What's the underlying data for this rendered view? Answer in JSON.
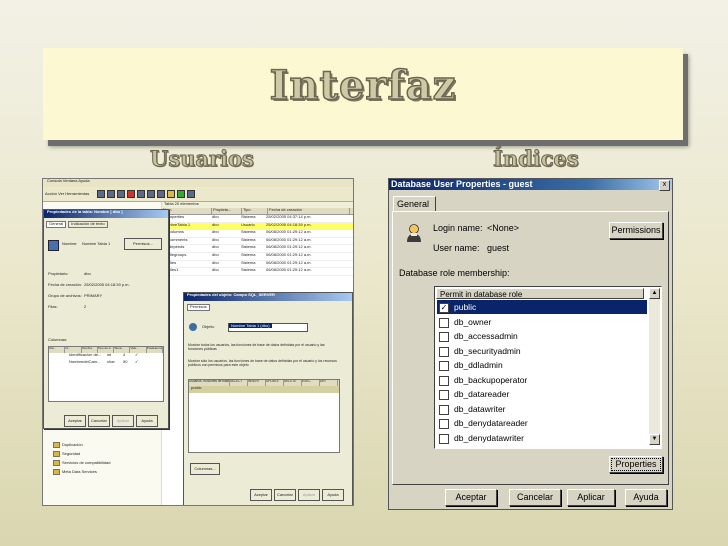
{
  "slide": {
    "title": "Interfaz",
    "left_label": "Usuarios",
    "right_label": "Índices"
  },
  "left_shot": {
    "menu": "Consola  Ventana  Ayuda",
    "toolbar_text": "Acción  Ver  Herramientas",
    "table_header": "Tabla   20 elementos",
    "columns": [
      "Nom",
      "Propieta...",
      "Tipo",
      "Fecha de creación"
    ],
    "rows": [
      [
        "dtproperties",
        "dbo",
        "Sistema",
        "25/02/2005 04:37:14 p.m."
      ],
      [
        "NombreTabla 1",
        "dbo",
        "Usuario",
        "25/02/2005 04:18:39 p.m."
      ],
      [
        "syscolumns",
        "dbo",
        "Sistema",
        "06/08/2000 01:29:12 a.m."
      ],
      [
        "syscomments",
        "dbo",
        "Sistema",
        "06/08/2000 01:29:12 a.m."
      ],
      [
        "sysdepends",
        "dbo",
        "Sistema",
        "06/08/2000 01:29:12 a.m."
      ],
      [
        "sysfilegroups",
        "dbo",
        "Sistema",
        "06/08/2000 01:29:12 a.m."
      ],
      [
        "sysfiles",
        "dbo",
        "Sistema",
        "06/08/2000 01:29:12 a.m."
      ],
      [
        "sysfiles1",
        "dbo",
        "Sistema",
        "06/08/2000 01:29:12 a.m."
      ]
    ],
    "props_dialog": {
      "title": "Propiedades de la tabla: Nombre [ dbo ]",
      "tabs": [
        "General",
        "Indicación de texto"
      ],
      "name_label": "Nombre:",
      "name_value": "Nombre Tabla 1",
      "perms_button": "Permisos...",
      "fields": [
        [
          "Propietario:",
          "dbo"
        ],
        [
          "Fecha de creación:",
          "25/02/2005 04:18:39 p.m."
        ],
        [
          "Grupo de archivos:",
          "PRIMARY"
        ],
        [
          "Filas:",
          "2"
        ]
      ],
      "columns_label": "Columnas:",
      "col_headers": [
        "Cla...",
        "Id...",
        "Nombre",
        "Tipo de d...",
        "Tama...",
        "Valo...",
        "Predetermin..."
      ],
      "col_rows": [
        [
          "",
          "",
          "Identificación de...",
          "int",
          "4",
          "✓"
        ],
        [
          "",
          "",
          "NombredelCam...",
          "char",
          "50",
          "✓"
        ]
      ],
      "buttons": [
        "Aceptar",
        "Cancelar",
        "Aplicar",
        "Ayuda"
      ]
    },
    "perm_dialog": {
      "title": "Propiedades del objeto: Campo SQL_SERVER",
      "tab": "Permisos",
      "object_label": "Objeto:",
      "object_value": "Nombre Tabla 1 (dbo)",
      "option1": "Mostrar todos los usuarios, las funciones de base de datos definidas por el usuario y las funciones públicas",
      "option2": "Mostrar sólo los usuarios, las funciones de base de datos definidas por el usuario y los recursos públicos con permisos para este objeto",
      "grid_headers": [
        "Usuarios, funciones de base",
        "SELECT",
        "INSERT",
        "UPDATE",
        "DELETE",
        "EXEC",
        "DRI"
      ],
      "grid_row": "public",
      "users_button": "Columnas...",
      "buttons": [
        "Aceptar",
        "Cancelar",
        "Aplicar",
        "Ayuda"
      ]
    },
    "tree_items": [
      "Duplicación",
      "Seguridad",
      "Servicios de compatibilidad",
      "Meta Data Services"
    ]
  },
  "right_shot": {
    "window_title": "Database User Properties - guest",
    "close_glyph": "x",
    "tab": "General",
    "login_label": "Login name:",
    "login_value": "<None>",
    "user_label": "User name:",
    "user_value": "guest",
    "permissions_button": "Permissions",
    "role_label": "Database role membership:",
    "list_header": "Permit in database role",
    "roles": [
      {
        "name": "public",
        "checked": true,
        "selected": true
      },
      {
        "name": "db_owner",
        "checked": false,
        "selected": false
      },
      {
        "name": "db_accessadmin",
        "checked": false,
        "selected": false
      },
      {
        "name": "db_securityadmin",
        "checked": false,
        "selected": false
      },
      {
        "name": "db_ddladmin",
        "checked": false,
        "selected": false
      },
      {
        "name": "db_backupoperator",
        "checked": false,
        "selected": false
      },
      {
        "name": "db_datareader",
        "checked": false,
        "selected": false
      },
      {
        "name": "db_datawriter",
        "checked": false,
        "selected": false
      },
      {
        "name": "db_denydatareader",
        "checked": false,
        "selected": false
      },
      {
        "name": "db_denydatawriter",
        "checked": false,
        "selected": false
      }
    ],
    "properties_button": "Properties",
    "buttons": [
      "Aceptar",
      "Cancelar",
      "Aplicar",
      "Ayuda"
    ]
  }
}
